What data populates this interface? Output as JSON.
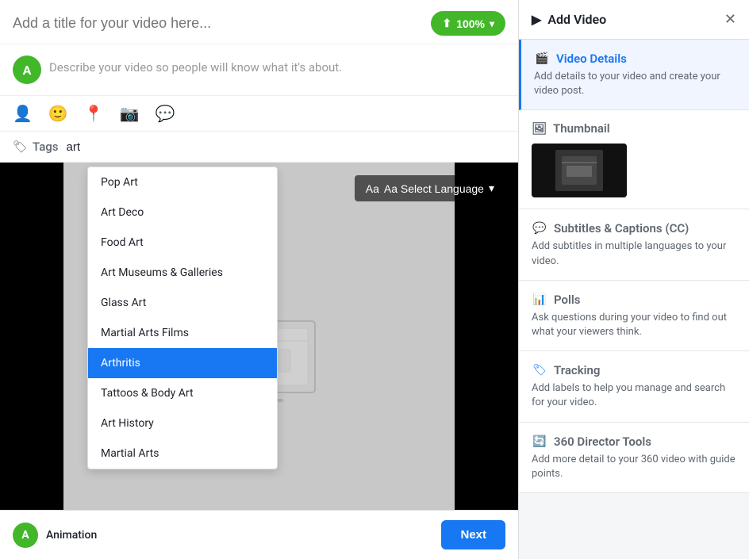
{
  "left": {
    "title_placeholder": "Add a title for your video here...",
    "upload_btn": "100%",
    "description_placeholder": "Describe your video so people will know what it's about.",
    "avatar_initial": "A",
    "tags_label": "Tags",
    "tags_input_value": "art",
    "dropdown_items": [
      {
        "label": "Pop Art",
        "selected": false
      },
      {
        "label": "Art Deco",
        "selected": false
      },
      {
        "label": "Food Art",
        "selected": false
      },
      {
        "label": "Art Museums & Galleries",
        "selected": false
      },
      {
        "label": "Glass Art",
        "selected": false
      },
      {
        "label": "Martial Arts Films",
        "selected": false
      },
      {
        "label": "Arthritis",
        "selected": true
      },
      {
        "label": "Tattoos & Body Art",
        "selected": false
      },
      {
        "label": "Art History",
        "selected": false
      },
      {
        "label": "Martial Arts",
        "selected": false
      }
    ],
    "select_language_btn": "Aa Select Language"
  },
  "right": {
    "panel_title": "Add Video",
    "sections": [
      {
        "id": "video-details",
        "icon": "film",
        "title": "Video Details",
        "desc": "Add details to your video and create your video post.",
        "active": true
      },
      {
        "id": "thumbnail",
        "icon": "image",
        "title": "Thumbnail",
        "desc": ""
      },
      {
        "id": "subtitles",
        "icon": "cc",
        "title": "Subtitles & Captions (CC)",
        "desc": "Add subtitles in multiple languages to your video."
      },
      {
        "id": "polls",
        "icon": "chart",
        "title": "Polls",
        "desc": "Ask questions during your video to find out what your viewers think."
      },
      {
        "id": "tracking",
        "icon": "tag",
        "title": "Tracking",
        "desc": "Add labels to help you manage and search for your video."
      },
      {
        "id": "360-tools",
        "icon": "360",
        "title": "360 Director Tools",
        "desc": "Add more detail to your 360 video with guide points."
      }
    ]
  },
  "bottom": {
    "avatar_initial": "A",
    "page_name": "Animation",
    "next_btn": "Next"
  }
}
